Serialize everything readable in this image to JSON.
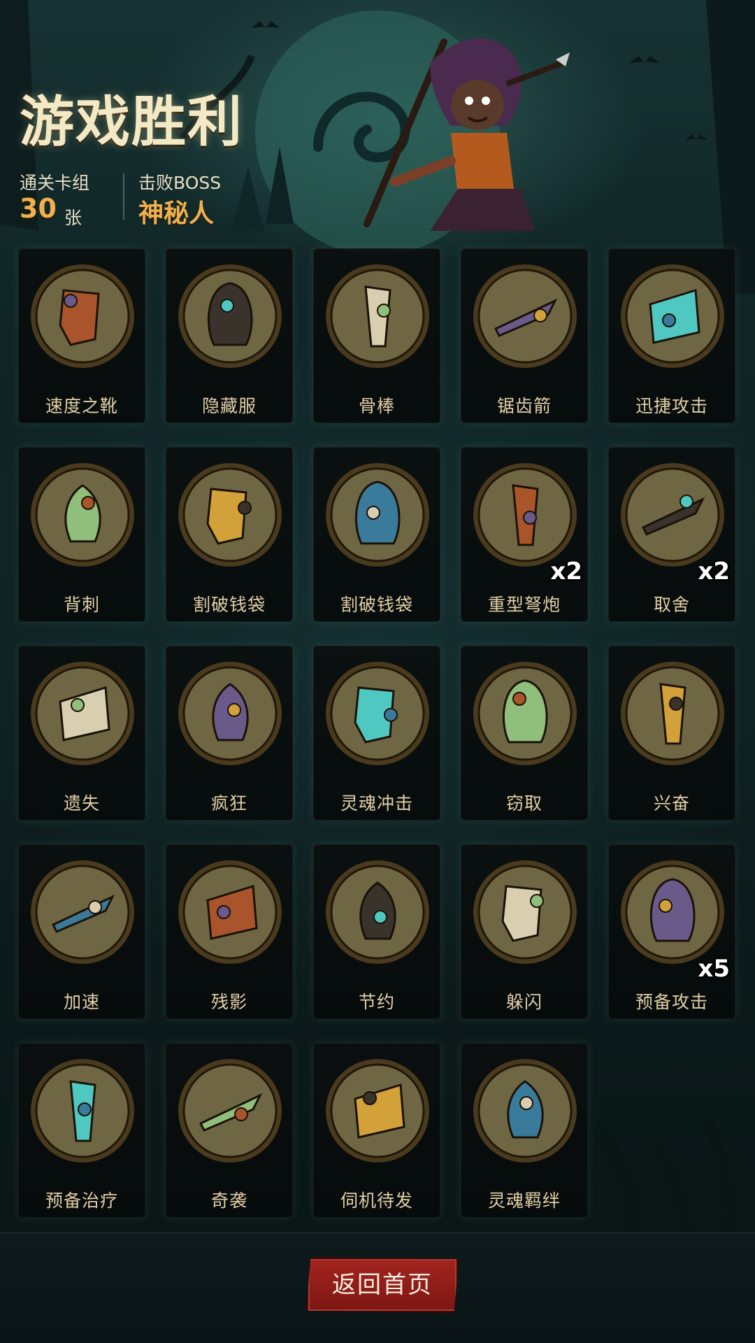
{
  "header": {
    "title": "游戏胜利",
    "clear_deck_label": "通关卡组",
    "clear_deck_value": "30",
    "clear_deck_unit": "张",
    "boss_label": "击败BOSS",
    "boss_name": "神秘人"
  },
  "cards": [
    {
      "name": "速度之靴",
      "icon": "speed-boots-icon"
    },
    {
      "name": "隐藏服",
      "icon": "hooded-cloak-icon"
    },
    {
      "name": "骨棒",
      "icon": "bone-club-icon"
    },
    {
      "name": "锯齿箭",
      "icon": "serrated-arrow-icon"
    },
    {
      "name": "迅捷攻击",
      "icon": "swift-strike-icon"
    },
    {
      "name": "背刺",
      "icon": "backstab-icon"
    },
    {
      "name": "割破钱袋",
      "icon": "cut-purse-icon"
    },
    {
      "name": "割破钱袋",
      "icon": "cut-purse-icon"
    },
    {
      "name": "重型弩炮",
      "icon": "heavy-ballista-icon",
      "count": "x2"
    },
    {
      "name": "取舍",
      "icon": "old-sage-icon",
      "count": "x2"
    },
    {
      "name": "遗失",
      "icon": "lost-loot-icon"
    },
    {
      "name": "疯狂",
      "icon": "pumpkin-madness-icon"
    },
    {
      "name": "灵魂冲击",
      "icon": "soul-blast-icon"
    },
    {
      "name": "窃取",
      "icon": "goblin-steal-icon"
    },
    {
      "name": "兴奋",
      "icon": "excited-hammer-icon"
    },
    {
      "name": "加速",
      "icon": "witch-haste-icon"
    },
    {
      "name": "残影",
      "icon": "afterimage-icon"
    },
    {
      "name": "节约",
      "icon": "water-drop-icon"
    },
    {
      "name": "躲闪",
      "icon": "dodge-icon"
    },
    {
      "name": "预备攻击",
      "icon": "ready-attack-icon",
      "count": "x5"
    },
    {
      "name": "预备治疗",
      "icon": "heal-heart-icon"
    },
    {
      "name": "奇袭",
      "icon": "ambush-icon"
    },
    {
      "name": "伺机待发",
      "icon": "ninja-wait-icon"
    },
    {
      "name": "灵魂羁绊",
      "icon": "soul-bond-icon"
    }
  ],
  "footer": {
    "home_button_label": "返回首页"
  },
  "colors": {
    "accent": "#f0b04c",
    "card_frame": "#4a3a1e",
    "card_fill": "#6f6743",
    "button": "#a3241e"
  }
}
